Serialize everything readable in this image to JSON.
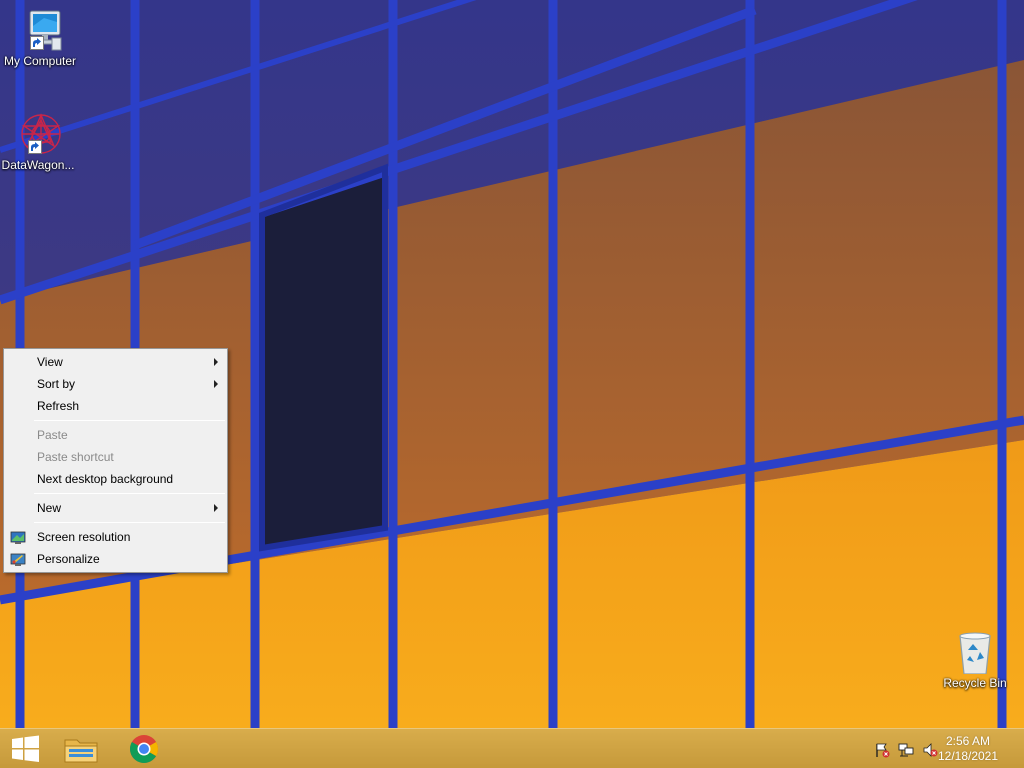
{
  "desktop": {
    "icons": [
      {
        "label": "My Computer",
        "icon": "my-computer-icon"
      },
      {
        "label": "DataWagon...",
        "icon": "datawagon-icon"
      },
      {
        "label": "Recycle Bin",
        "icon": "recycle-bin-icon"
      }
    ]
  },
  "context_menu": {
    "items": [
      {
        "label": "View",
        "submenu": true,
        "enabled": true
      },
      {
        "label": "Sort by",
        "submenu": true,
        "enabled": true
      },
      {
        "label": "Refresh",
        "submenu": false,
        "enabled": true
      },
      {
        "label": "Paste",
        "submenu": false,
        "enabled": false
      },
      {
        "label": "Paste shortcut",
        "submenu": false,
        "enabled": false
      },
      {
        "label": "Next desktop background",
        "submenu": false,
        "enabled": true
      },
      {
        "label": "New",
        "submenu": true,
        "enabled": true
      },
      {
        "label": "Screen resolution",
        "icon": "screen-resolution-icon",
        "enabled": true
      },
      {
        "label": "Personalize",
        "icon": "personalize-icon",
        "enabled": true
      }
    ]
  },
  "taskbar": {
    "pinned": [
      "start-button",
      "file-explorer-icon",
      "chrome-icon"
    ],
    "tray_icons": [
      "action-center-flag-icon",
      "network-icon",
      "volume-muted-icon"
    ],
    "clock": {
      "time": "2:56 AM",
      "date": "12/18/2021"
    }
  },
  "colors": {
    "menu_bg": "#f0f0f0",
    "taskbar": "#c99a3c",
    "frame_blue": "#2a3ec4",
    "glass_orange": "#f5a51c"
  }
}
